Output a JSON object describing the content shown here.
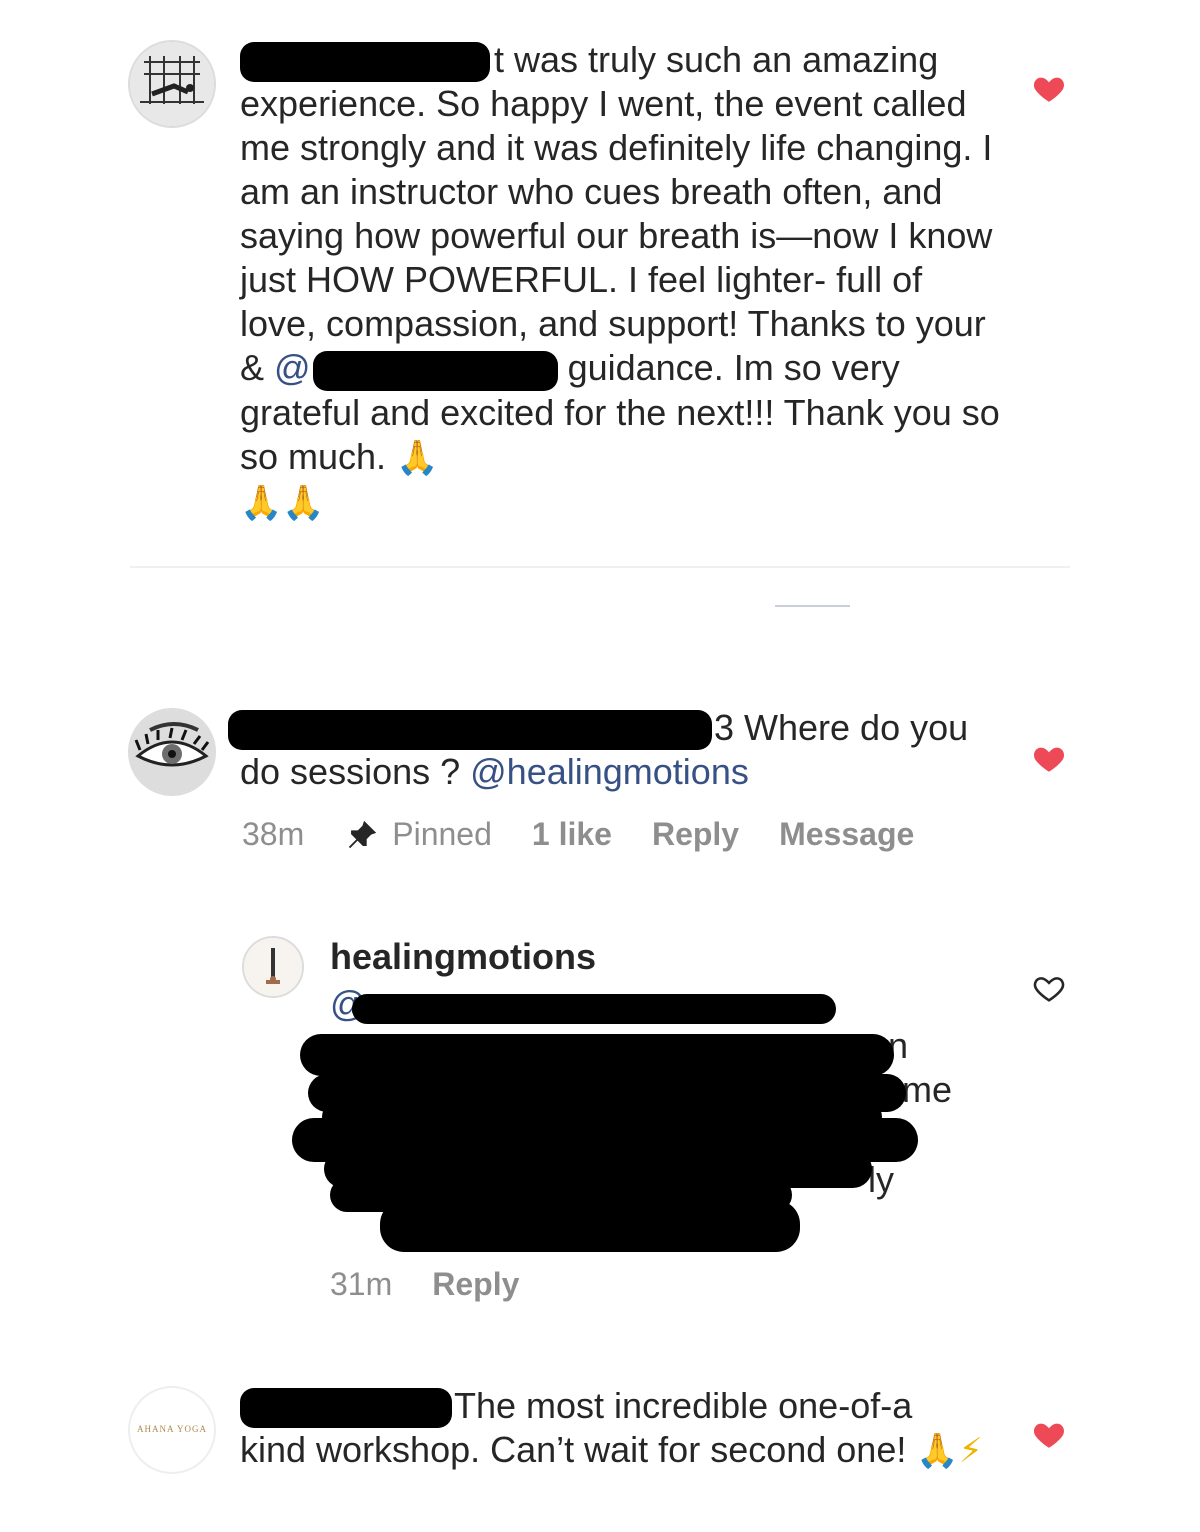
{
  "comments": [
    {
      "text_lead": "t was truly such an",
      "text_body": "amazing experience. So happy I went, the event called me strongly and it was definitely life changing. I am an instructor who cues breath often, and saying how powerful our breath is—now I know just HOW POWERFUL. I feel lighter- full of love, compassion, and support! Thanks to your & ",
      "mention_prefix": "@",
      "text_tail": "guidance. Im so very grateful and excited for the next!!! Thank you so so much.",
      "emoji": "🙏",
      "liked": true
    },
    {
      "text_lead": "3 Where do you",
      "text_body": "do sessions ? ",
      "mention": "@healingmotions",
      "time": "38m",
      "pinned_label": "Pinned",
      "likes": "1 like",
      "reply_label": "Reply",
      "message_label": "Message",
      "liked": true
    },
    {
      "text_lead": "The most incredible one-of-a",
      "text_body": "kind workshop. Can’t wait for second one!",
      "emoji": "🙏",
      "emoji2": "⚡",
      "avatar_text": "AHANA YOGA",
      "liked": true
    }
  ],
  "reply": {
    "username": "healingmotions",
    "mention_prefix": "@",
    "fragment1": "n",
    "fragment2": "me",
    "fragment3": "ly",
    "time": "31m",
    "reply_label": "Reply",
    "liked": false
  },
  "colors": {
    "heart_red": "#ed4956",
    "mention_blue": "#385185",
    "meta_gray": "#8e8e8e"
  },
  "icons": [
    "heart-icon",
    "pin-icon",
    "heart-outline-icon"
  ]
}
